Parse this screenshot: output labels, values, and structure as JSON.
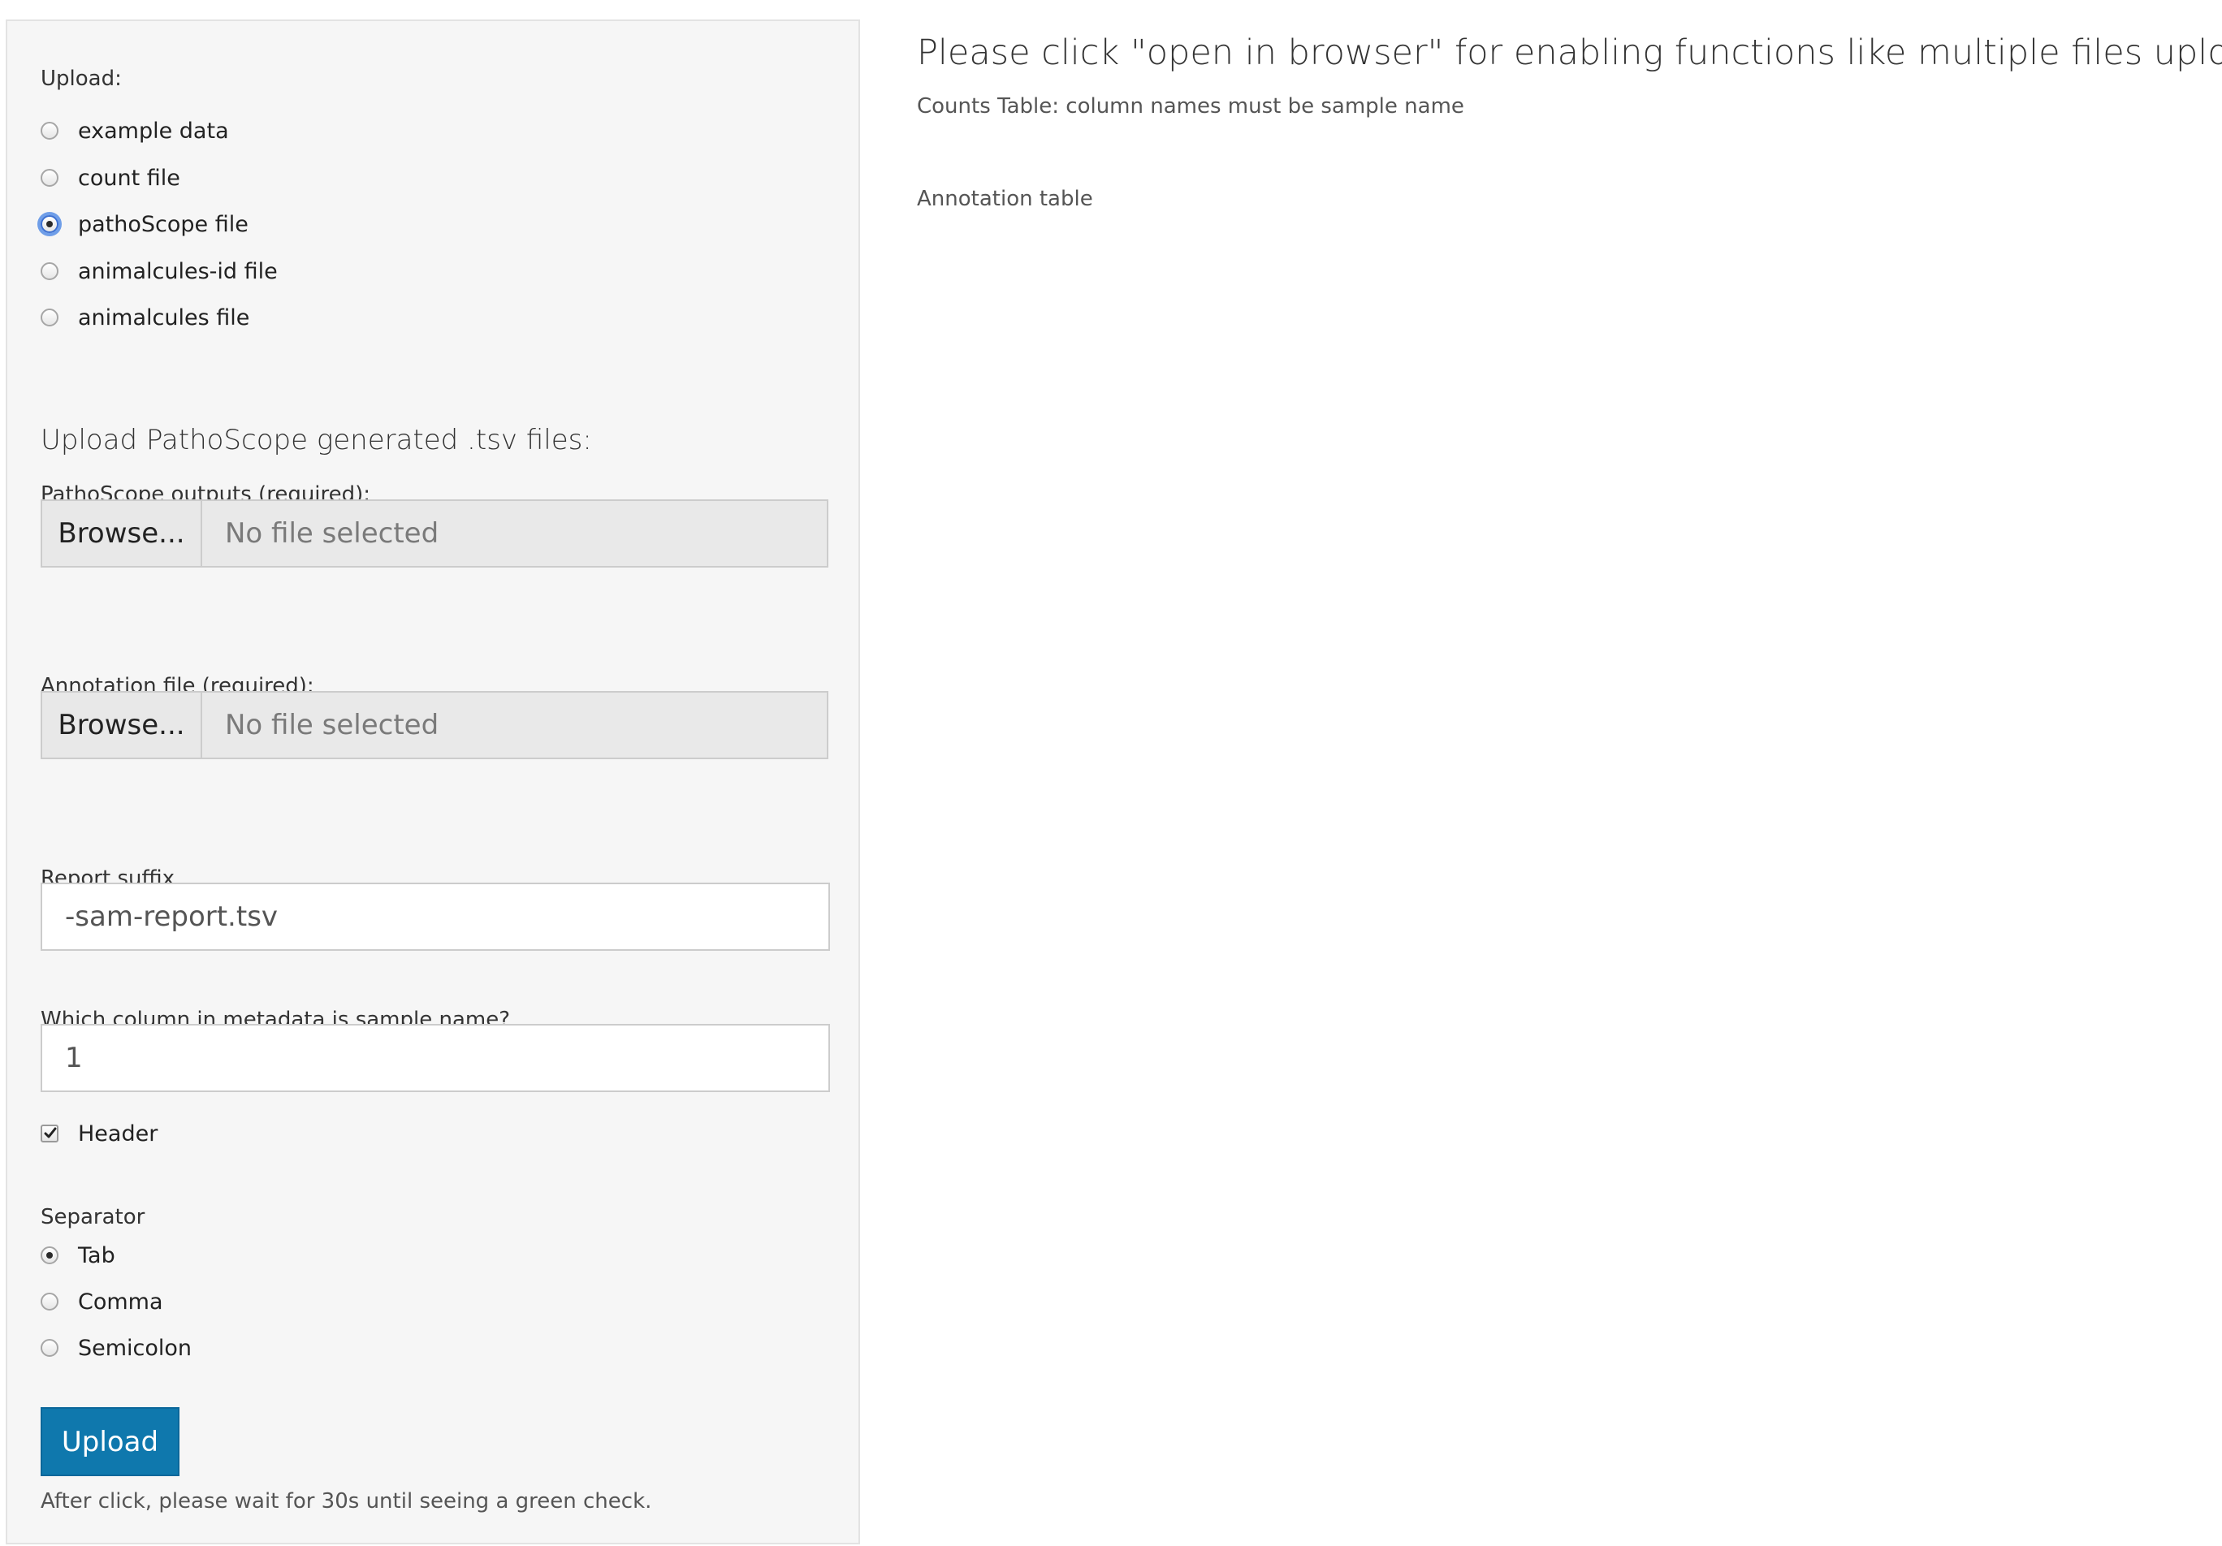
{
  "sidebar": {
    "upload_label": "Upload:",
    "upload_options": [
      {
        "label": "example data",
        "checked": false
      },
      {
        "label": "count file",
        "checked": false
      },
      {
        "label": "pathoScope file",
        "checked": true
      },
      {
        "label": "animalcules-id file",
        "checked": false
      },
      {
        "label": "animalcules file",
        "checked": false
      }
    ],
    "section_title": "Upload PathoScope generated .tsv files:",
    "pathoscope_label": "PathoScope outputs (required):",
    "pathoscope_browse": "Browse...",
    "pathoscope_status": "No file selected",
    "annotation_label": "Annotation file (required):",
    "annotation_browse": "Browse...",
    "annotation_status": "No file selected",
    "report_suffix_label": "Report suffix",
    "report_suffix_value": "-sam-report.tsv",
    "sample_column_label": "Which column in metadata is sample name?",
    "sample_column_value": "1",
    "header_label": "Header",
    "header_checked": true,
    "separator_label": "Separator",
    "separator_options": [
      {
        "label": "Tab",
        "checked": true
      },
      {
        "label": "Comma",
        "checked": false
      },
      {
        "label": "Semicolon",
        "checked": false
      }
    ],
    "upload_button": "Upload",
    "help_text": "After click, please wait for 30s until seeing a green check."
  },
  "main": {
    "title": "Please click \"open in browser\" for enabling functions like multiple files upload.",
    "counts_table_text": "Counts Table: column names must be sample name",
    "annotation_table_text": "Annotation table"
  },
  "colors": {
    "upload_button_bg": "#0f78ad",
    "panel_bg": "#f6f6f6",
    "focus_ring": "#6f9ee8"
  }
}
